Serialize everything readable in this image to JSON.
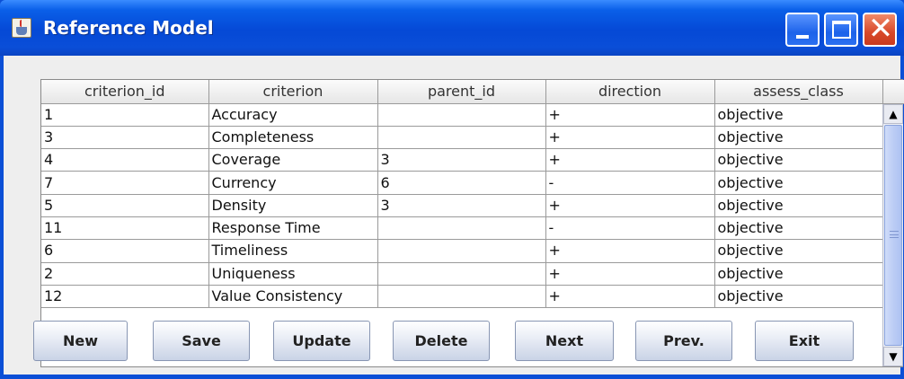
{
  "window": {
    "title": "Reference Model"
  },
  "table": {
    "columns": [
      "criterion_id",
      "criterion",
      "parent_id",
      "direction",
      "assess_class"
    ],
    "rows": [
      [
        "1",
        "Accuracy",
        "",
        "+",
        "objective"
      ],
      [
        "3",
        "Completeness",
        "",
        "+",
        "objective"
      ],
      [
        "4",
        "Coverage",
        "3",
        "+",
        "objective"
      ],
      [
        "7",
        "Currency",
        "6",
        "-",
        "objective"
      ],
      [
        "5",
        "Density",
        "3",
        "+",
        "objective"
      ],
      [
        "11",
        "Response Time",
        "",
        "-",
        "objective"
      ],
      [
        "6",
        "Timeliness",
        "",
        "+",
        "objective"
      ],
      [
        "2",
        "Uniqueness",
        "",
        "+",
        "objective"
      ],
      [
        "12",
        "Value Consistency",
        "",
        "+",
        "objective"
      ]
    ]
  },
  "scrollbar": {
    "up_arrow": "▲",
    "down_arrow": "▼"
  },
  "buttons": {
    "new": "New",
    "save": "Save",
    "update": "Update",
    "delete": "Delete",
    "next": "Next",
    "prev": "Prev.",
    "exit": "Exit"
  },
  "titlebar_buttons": {
    "close_glyph": "✕"
  },
  "colors": {
    "titlebar": "#0549d6",
    "close_button": "#d8482a",
    "scroll_thumb": "#bccdf5"
  }
}
